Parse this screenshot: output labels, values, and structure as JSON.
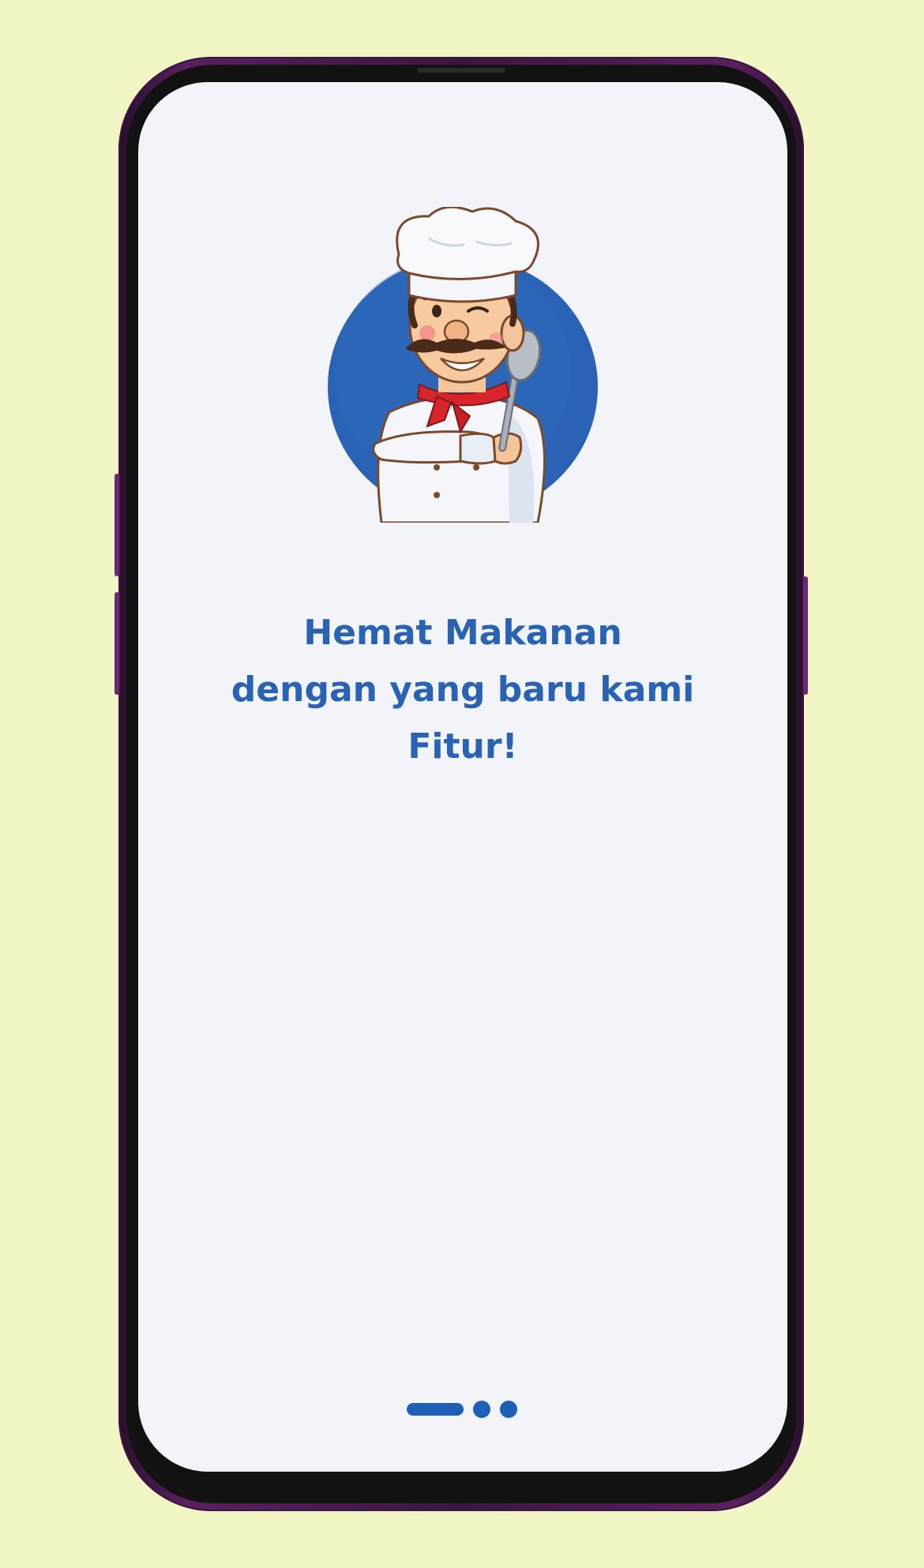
{
  "onboarding": {
    "headline_line1": "Hemat Makanan",
    "headline_line2": "dengan yang baru kami",
    "headline_line3": "Fitur!",
    "pager": {
      "total_pages": 3,
      "active_page": 1
    }
  },
  "colors": {
    "background": "#f2f6c5",
    "screen": "#f3f4f9",
    "accent_blue": "#2a63b4",
    "frame_purple": "#5a2060"
  },
  "icons": {
    "mascot": "chef-mascot-icon"
  }
}
